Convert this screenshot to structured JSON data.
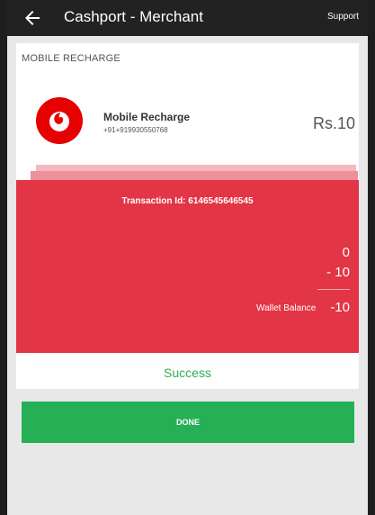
{
  "appbar": {
    "title": "Cashport - Merchant",
    "support_label": "Support",
    "back_icon": "arrow-left-icon"
  },
  "section": {
    "label": "MOBILE RECHARGE"
  },
  "item": {
    "logo_icon": "vodafone-logo-icon",
    "title": "Mobile Recharge",
    "phone": "+91+919930550768",
    "amount": "Rs.10"
  },
  "receipt": {
    "transaction_id": "Transaction Id: 6146545646545",
    "value_a": "0",
    "value_b": "- 10",
    "wallet_label": "Wallet Balance",
    "wallet_value": "-10"
  },
  "status": "Success",
  "done_label": "DONE",
  "colors": {
    "receipt_red": "#e23545",
    "success_green": "#2eae55",
    "button_green": "#25b055",
    "appbar": "#222222"
  }
}
